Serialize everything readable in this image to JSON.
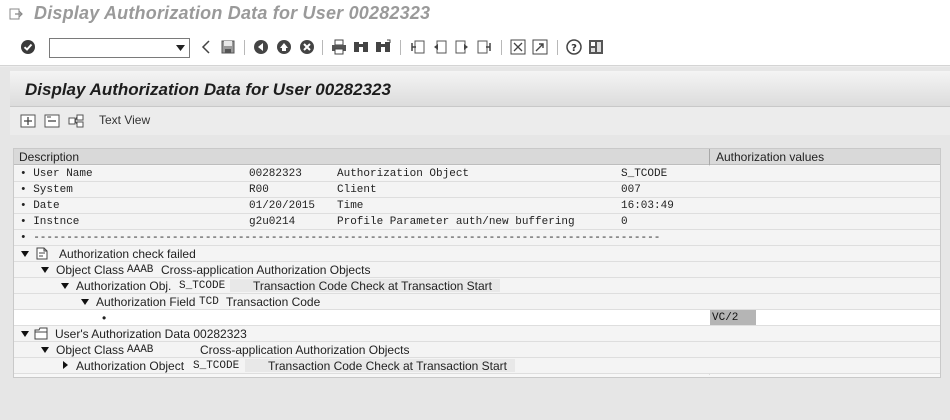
{
  "window": {
    "title": "Display Authorization Data for User 00282323"
  },
  "toolbar": {
    "command_field_value": "",
    "buttons": [
      "enter-icon",
      "back-arrow-icon",
      "save-icon",
      "back-icon",
      "exit-icon",
      "cancel-icon",
      "print-icon",
      "find-icon",
      "find-next-icon",
      "first-page-icon",
      "previous-page-icon",
      "next-page-icon",
      "last-page-icon",
      "create-session-icon",
      "shortcut-icon",
      "help-icon",
      "layout-icon"
    ]
  },
  "page": {
    "title": "Display Authorization Data for User 00282323"
  },
  "app_toolbar": {
    "text_view_label": "Text View"
  },
  "tree": {
    "col_description": "Description",
    "col_auth_values": "Authorization values",
    "header_rows": [
      {
        "c1": "• User Name",
        "c2": "00282323",
        "c3": "Authorization Object",
        "c4": "S_TCODE"
      },
      {
        "c1": "• System",
        "c2": "R00",
        "c3": "Client",
        "c4": "007"
      },
      {
        "c1": "• Date",
        "c2": "01/20/2015",
        "c3": "Time",
        "c4": "16:03:49"
      },
      {
        "c1": "• Instnce",
        "c2": "g2u0214",
        "c3": "Profile Parameter auth/new buffering",
        "c4": "0"
      }
    ],
    "dash_row": "• -----------------------------------------------------------------------------------------------",
    "failed_node": {
      "label": "Authorization check failed",
      "object_class_label": "Object Class",
      "object_class_code": "AAAB",
      "object_class_text": "Cross-application Authorization Objects",
      "auth_obj_label": "Authorization Obj.",
      "auth_obj_code": "S_TCODE",
      "auth_obj_text": "Transaction Code Check at Transaction Start",
      "auth_field_label": "Authorization Field",
      "auth_field_code": "TCD",
      "auth_field_text": "Transaction Code",
      "value_bullet": "•",
      "value": "VC/2"
    },
    "user_node": {
      "label": "User's Authorization Data 00282323",
      "object_class_label": "Object Class",
      "object_class_code": "AAAB",
      "object_class_text": "Cross-application Authorization Objects",
      "auth_obj_label": "Authorization Object",
      "auth_obj_code": "S_TCODE",
      "auth_obj_text": "Transaction Code Check at Transaction Start"
    }
  }
}
